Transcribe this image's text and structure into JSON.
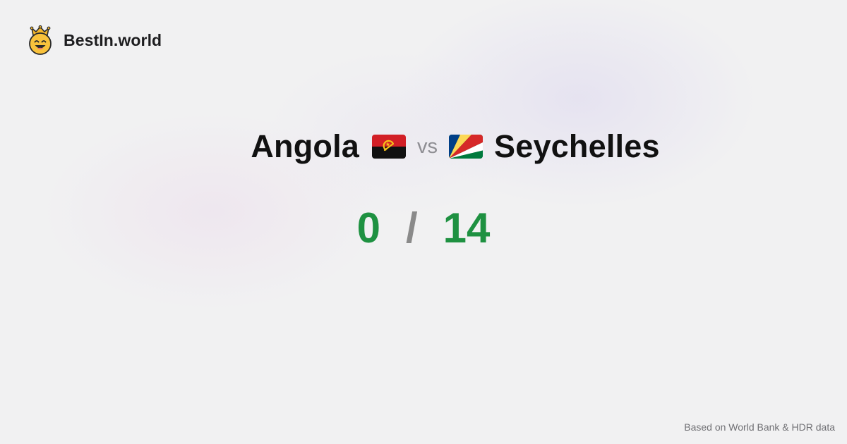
{
  "brand": {
    "name": "BestIn.world",
    "logo_icon": "crowned-smiley-icon"
  },
  "comparison": {
    "left": {
      "country": "Angola",
      "flag_icon": "angola-flag-icon",
      "score": "0"
    },
    "separator": "vs",
    "right": {
      "country": "Seychelles",
      "flag_icon": "seychelles-flag-icon",
      "score": "14"
    },
    "score_separator": "/"
  },
  "footer": {
    "source_text": "Based on World Bank & HDR data"
  },
  "colors": {
    "score_green": "#1e9141",
    "vs_gray": "#8e8e93",
    "background": "#f1f1f2"
  }
}
